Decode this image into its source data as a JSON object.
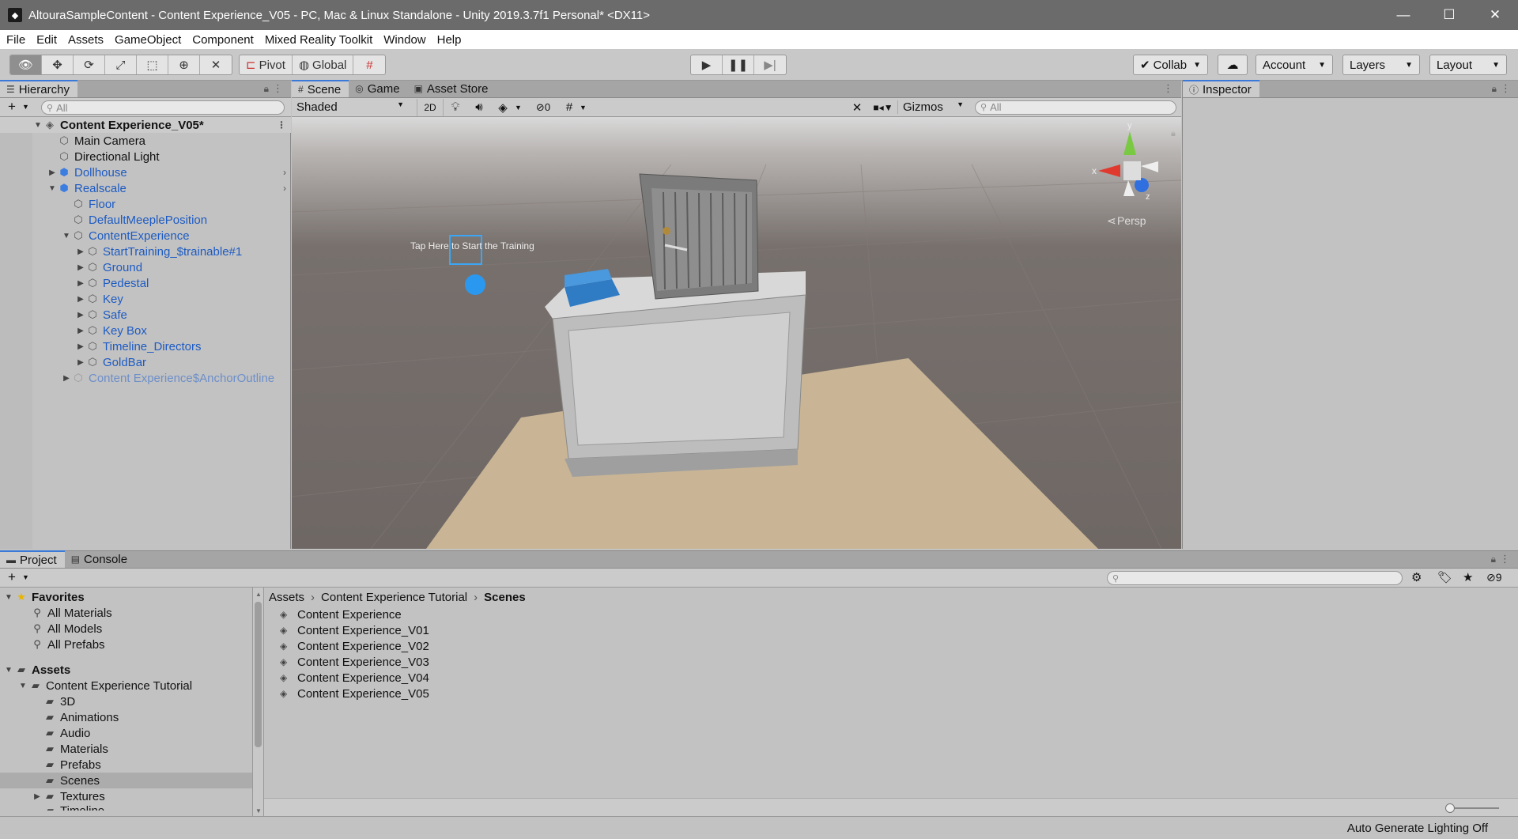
{
  "window": {
    "title": "AltouraSampleContent - Content Experience_V05 - PC, Mac & Linux Standalone - Unity 2019.3.7f1 Personal* <DX11>",
    "minimize": "—",
    "maximize": "☐",
    "close": "✕"
  },
  "menu": [
    "File",
    "Edit",
    "Assets",
    "GameObject",
    "Component",
    "Mixed Reality Toolkit",
    "Window",
    "Help"
  ],
  "toolbar": {
    "pivot": "Pivot",
    "global": "Global",
    "collab": "Collab",
    "account": "Account",
    "layers": "Layers",
    "layout": "Layout"
  },
  "hierarchy": {
    "tab": "Hierarchy",
    "search_placeholder": "All",
    "scene": "Content Experience_V05*",
    "items": [
      {
        "label": "Main Camera"
      },
      {
        "label": "Directional Light"
      },
      {
        "label": "Dollhouse"
      },
      {
        "label": "Realscale"
      },
      {
        "label": "Floor"
      },
      {
        "label": "DefaultMeeplePosition"
      },
      {
        "label": "ContentExperience"
      },
      {
        "label": "StartTraining_$trainable#1"
      },
      {
        "label": "Ground"
      },
      {
        "label": "Pedestal"
      },
      {
        "label": "Key"
      },
      {
        "label": "Safe"
      },
      {
        "label": "Key Box"
      },
      {
        "label": "Timeline_Directors"
      },
      {
        "label": "GoldBar"
      },
      {
        "label": "Content Experience$AnchorOutline"
      }
    ]
  },
  "scene": {
    "tabs": [
      "Scene",
      "Game",
      "Asset Store"
    ],
    "shading": "Shaded",
    "mode_2d": "2D",
    "hidden_count": "0",
    "gizmos": "Gizmos",
    "search_placeholder": "All",
    "persp": "Persp",
    "gizmo_y": "y",
    "gizmo_x": "x",
    "gizmo_z": "z",
    "world_text": "Tap Here to Start the Training"
  },
  "inspector": {
    "tab": "Inspector"
  },
  "project": {
    "tabs": [
      "Project",
      "Console"
    ],
    "hidden_count": "9",
    "favorites": {
      "label": "Favorites",
      "items": [
        "All Materials",
        "All Models",
        "All Prefabs"
      ]
    },
    "assets": {
      "label": "Assets",
      "tutorial": "Content Experience Tutorial",
      "folders": [
        "3D",
        "Animations",
        "Audio",
        "Materials",
        "Prefabs",
        "Scenes",
        "Textures"
      ],
      "cut_off": "Timeline"
    },
    "breadcrumb": [
      "Assets",
      "Content Experience Tutorial",
      "Scenes"
    ],
    "files": [
      "Content Experience",
      "Content Experience_V01",
      "Content Experience_V02",
      "Content Experience_V03",
      "Content Experience_V04",
      "Content Experience_V05"
    ]
  },
  "status": {
    "lighting": "Auto Generate Lighting Off"
  },
  "colors": {
    "selection_blue": "#3a79d8",
    "object_blue": "#1d5bc2"
  }
}
